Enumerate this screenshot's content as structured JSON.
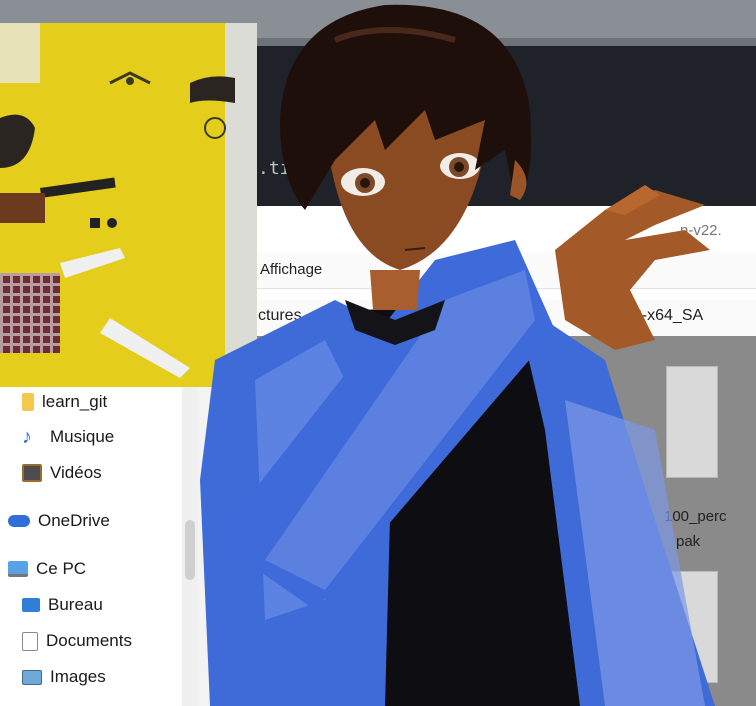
{
  "editor": {
    "snippet": ".ti"
  },
  "explorer": {
    "menu_label": "Affichage",
    "title_fragment": "n-v22.",
    "path_left": "ctures",
    "path_right": "win32-x64_SA",
    "file_label_line1": "100_perc",
    "file_label_line2": "pak"
  },
  "sidebar": {
    "items": [
      {
        "label": "learn_git",
        "icon": "folder-icon"
      },
      {
        "label": "Musique",
        "icon": "music-note-icon"
      },
      {
        "label": "Vidéos",
        "icon": "film-icon"
      },
      {
        "label": "OneDrive",
        "icon": "cloud-icon"
      },
      {
        "label": "Ce PC",
        "icon": "computer-icon"
      },
      {
        "label": "Bureau",
        "icon": "desktop-icon"
      },
      {
        "label": "Documents",
        "icon": "document-icon"
      },
      {
        "label": "Images",
        "icon": "image-icon"
      }
    ]
  },
  "colors": {
    "accent_blue": "#2f6fd6",
    "folder_yellow": "#f2c94c",
    "jacket_blue": "#3e6bd8",
    "skin": "#8a4a22",
    "hair": "#1e0f0a",
    "webcam_bg": "#e9d11c"
  }
}
